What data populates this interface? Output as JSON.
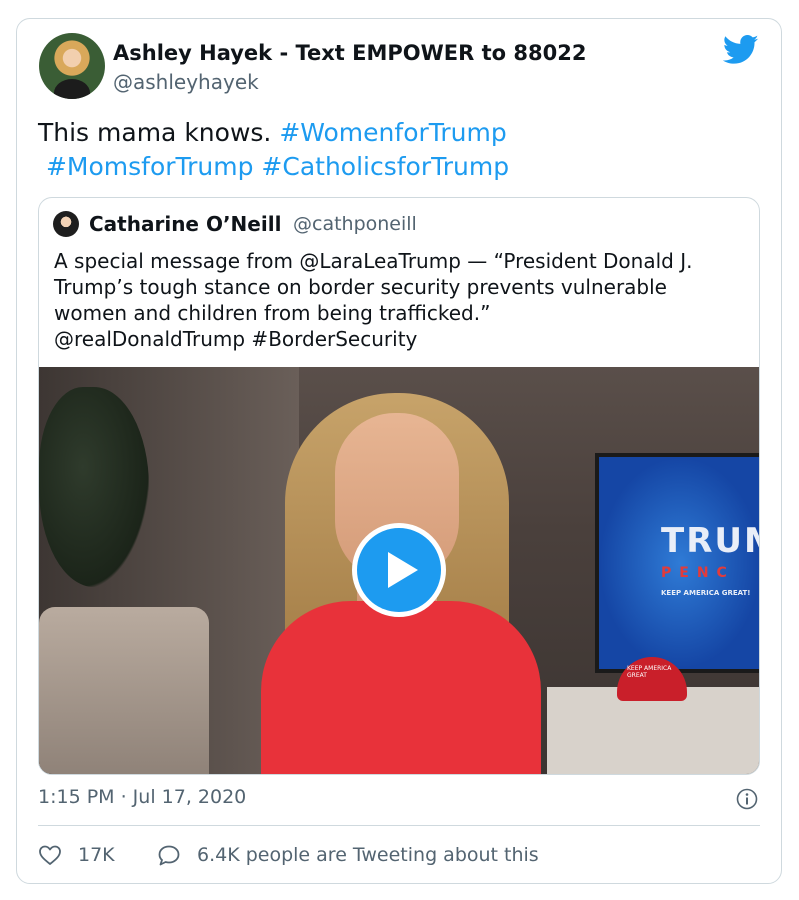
{
  "author": {
    "name": "Ashley Hayek - Text EMPOWER to 88022",
    "handle": "@ashleyhayek"
  },
  "tweet": {
    "text": "This mama knows. ",
    "hashtags": [
      "#WomenforTrump",
      "#MomsforTrump",
      "#CatholicsforTrump"
    ]
  },
  "quoted_tweet": {
    "author_name": "Catharine O’Neill",
    "author_handle": "@cathponeill",
    "lines": [
      "A special message from @LaraLeaTrump — “President Donald J.",
      "Trump’s tough stance on border security prevents vulnerable",
      "women and children from being trafficked.”",
      "@realDonaldTrump #BorderSecurity"
    ],
    "video": {
      "tv_text_large": "TRUM",
      "tv_text_mid": "PENC",
      "tv_text_small": "KEEP AMERICA GREAT!",
      "cap_text": "KEEP AMERICA GREAT"
    }
  },
  "timestamp": "1:15 PM · Jul 17, 2020",
  "actions": {
    "likes": "17K",
    "conversation": "6.4K people are Tweeting about this"
  },
  "colors": {
    "accent": "#1d9bf0",
    "text": "#0f1419",
    "secondary": "#536471",
    "border": "#cfd9de"
  },
  "icons": [
    "twitter-bird-icon",
    "play-icon",
    "info-icon",
    "heart-icon",
    "speech-bubble-icon"
  ]
}
